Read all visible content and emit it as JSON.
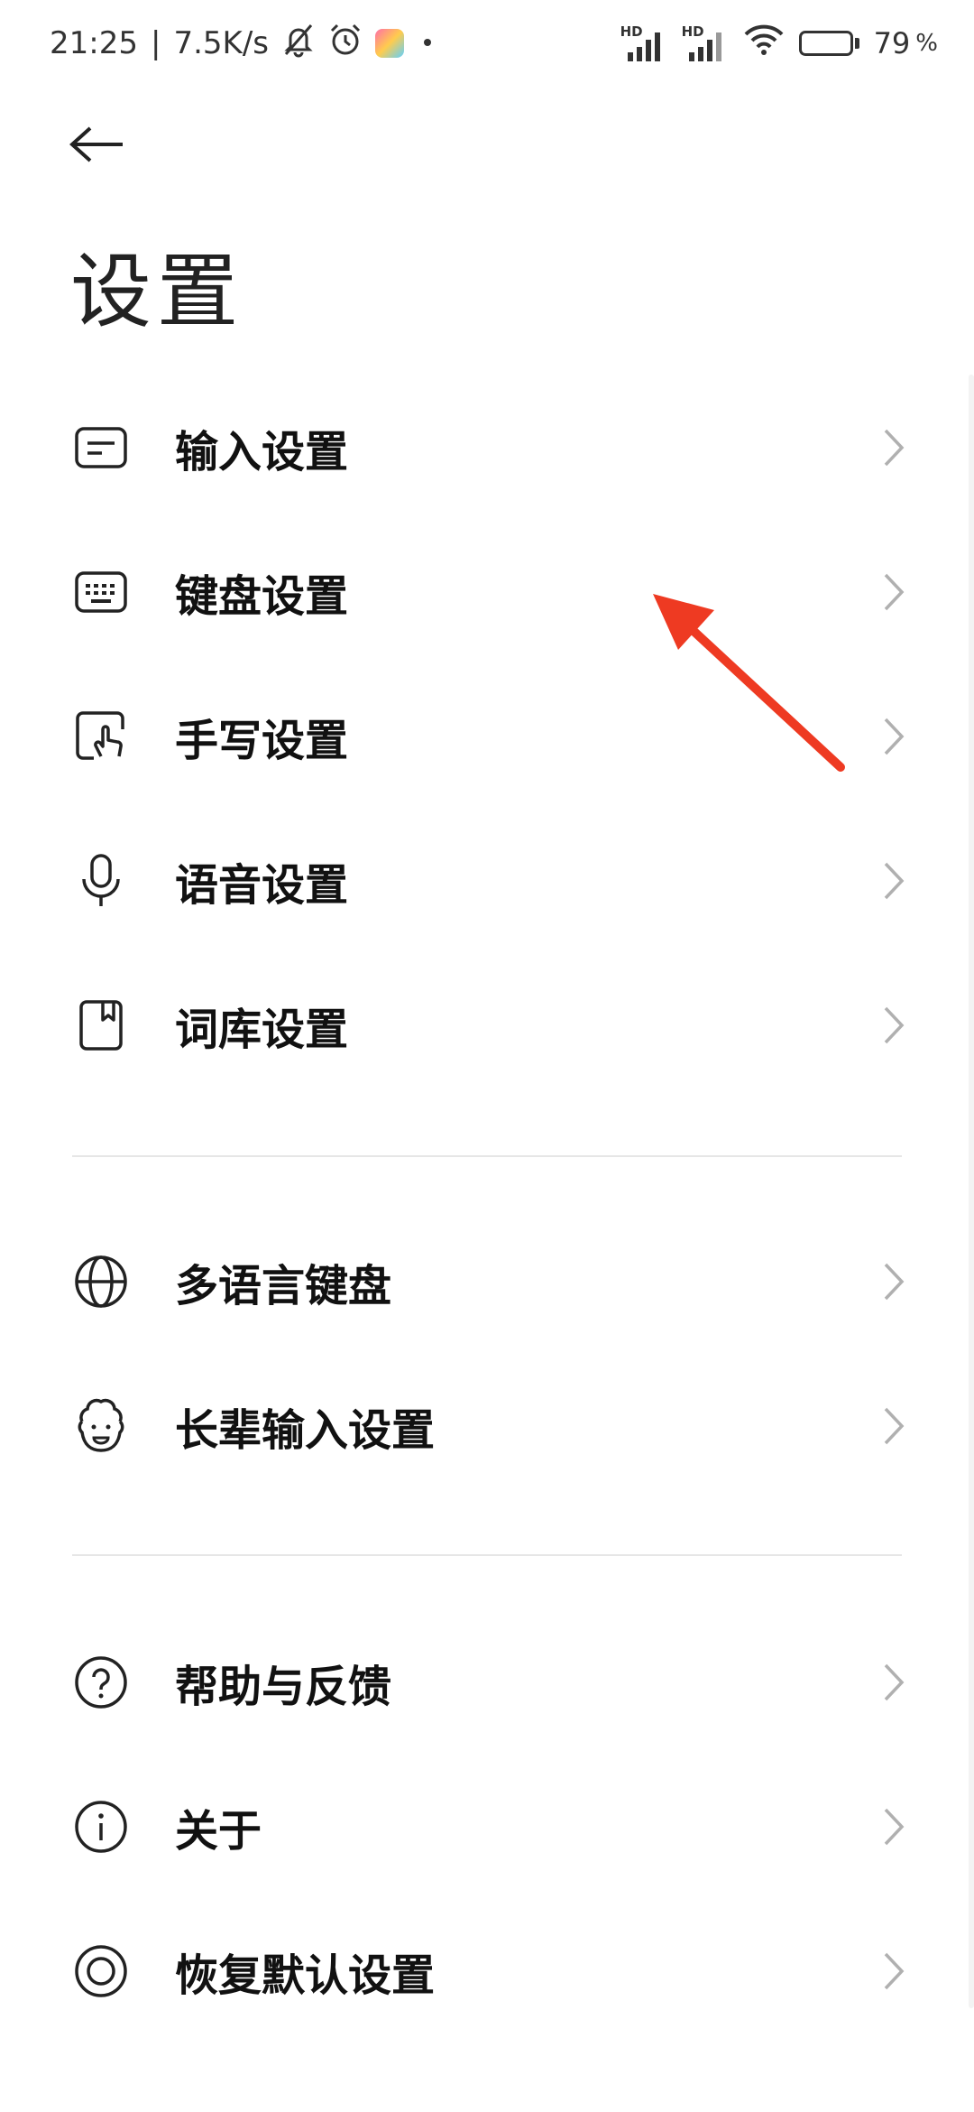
{
  "status_bar": {
    "time": "21:25",
    "separator": "|",
    "net_speed": "7.5K/s",
    "battery_percent": "79",
    "battery_level": 0.79,
    "percent_sign": "%",
    "sim1_label": "HD",
    "sim2_label": "HD",
    "icons": [
      "bell-off-icon",
      "alarm-icon",
      "app-notification-icon",
      "dot-icon",
      "signal-icon",
      "signal-icon",
      "wifi-icon",
      "battery-icon"
    ]
  },
  "header": {
    "back_icon": "arrow-left-icon",
    "title": "设置"
  },
  "groups": [
    {
      "items": [
        {
          "label": "输入设置",
          "icon": "input-settings-icon"
        },
        {
          "label": "键盘设置",
          "icon": "keyboard-icon"
        },
        {
          "label": "手写设置",
          "icon": "handwriting-icon"
        },
        {
          "label": "语音设置",
          "icon": "microphone-icon"
        },
        {
          "label": "词库设置",
          "icon": "dictionary-icon"
        }
      ]
    },
    {
      "items": [
        {
          "label": "多语言键盘",
          "icon": "globe-icon"
        },
        {
          "label": "长辈输入设置",
          "icon": "elder-face-icon"
        }
      ]
    },
    {
      "items": [
        {
          "label": "帮助与反馈",
          "icon": "help-circle-icon"
        },
        {
          "label": "关于",
          "icon": "info-circle-icon"
        },
        {
          "label": "恢复默认设置",
          "icon": "restore-circle-icon"
        }
      ]
    }
  ],
  "colors": {
    "annotation_arrow": "#ee3a22",
    "divider": "#e6e6e6",
    "chevron": "#b0b0b0"
  }
}
